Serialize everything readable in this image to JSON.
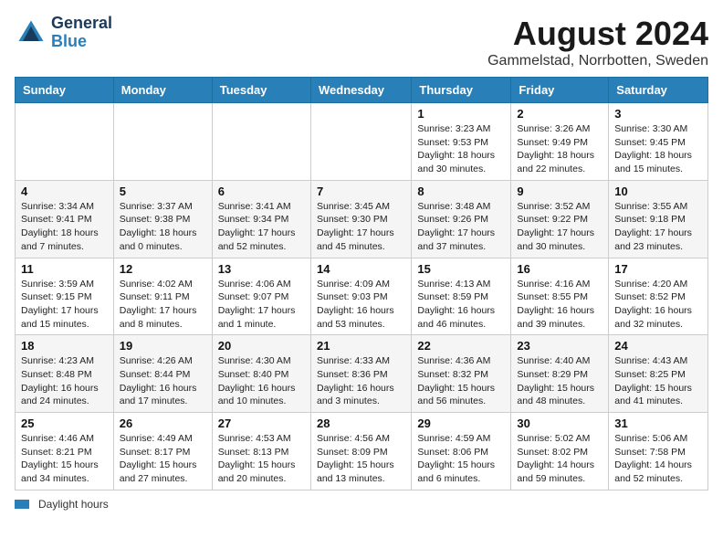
{
  "header": {
    "logo_line1": "General",
    "logo_line2": "Blue",
    "month": "August 2024",
    "location": "Gammelstad, Norrbotten, Sweden"
  },
  "columns": [
    "Sunday",
    "Monday",
    "Tuesday",
    "Wednesday",
    "Thursday",
    "Friday",
    "Saturday"
  ],
  "weeks": [
    [
      {
        "day": "",
        "info": ""
      },
      {
        "day": "",
        "info": ""
      },
      {
        "day": "",
        "info": ""
      },
      {
        "day": "",
        "info": ""
      },
      {
        "day": "1",
        "info": "Sunrise: 3:23 AM\nSunset: 9:53 PM\nDaylight: 18 hours\nand 30 minutes."
      },
      {
        "day": "2",
        "info": "Sunrise: 3:26 AM\nSunset: 9:49 PM\nDaylight: 18 hours\nand 22 minutes."
      },
      {
        "day": "3",
        "info": "Sunrise: 3:30 AM\nSunset: 9:45 PM\nDaylight: 18 hours\nand 15 minutes."
      }
    ],
    [
      {
        "day": "4",
        "info": "Sunrise: 3:34 AM\nSunset: 9:41 PM\nDaylight: 18 hours\nand 7 minutes."
      },
      {
        "day": "5",
        "info": "Sunrise: 3:37 AM\nSunset: 9:38 PM\nDaylight: 18 hours\nand 0 minutes."
      },
      {
        "day": "6",
        "info": "Sunrise: 3:41 AM\nSunset: 9:34 PM\nDaylight: 17 hours\nand 52 minutes."
      },
      {
        "day": "7",
        "info": "Sunrise: 3:45 AM\nSunset: 9:30 PM\nDaylight: 17 hours\nand 45 minutes."
      },
      {
        "day": "8",
        "info": "Sunrise: 3:48 AM\nSunset: 9:26 PM\nDaylight: 17 hours\nand 37 minutes."
      },
      {
        "day": "9",
        "info": "Sunrise: 3:52 AM\nSunset: 9:22 PM\nDaylight: 17 hours\nand 30 minutes."
      },
      {
        "day": "10",
        "info": "Sunrise: 3:55 AM\nSunset: 9:18 PM\nDaylight: 17 hours\nand 23 minutes."
      }
    ],
    [
      {
        "day": "11",
        "info": "Sunrise: 3:59 AM\nSunset: 9:15 PM\nDaylight: 17 hours\nand 15 minutes."
      },
      {
        "day": "12",
        "info": "Sunrise: 4:02 AM\nSunset: 9:11 PM\nDaylight: 17 hours\nand 8 minutes."
      },
      {
        "day": "13",
        "info": "Sunrise: 4:06 AM\nSunset: 9:07 PM\nDaylight: 17 hours\nand 1 minute."
      },
      {
        "day": "14",
        "info": "Sunrise: 4:09 AM\nSunset: 9:03 PM\nDaylight: 16 hours\nand 53 minutes."
      },
      {
        "day": "15",
        "info": "Sunrise: 4:13 AM\nSunset: 8:59 PM\nDaylight: 16 hours\nand 46 minutes."
      },
      {
        "day": "16",
        "info": "Sunrise: 4:16 AM\nSunset: 8:55 PM\nDaylight: 16 hours\nand 39 minutes."
      },
      {
        "day": "17",
        "info": "Sunrise: 4:20 AM\nSunset: 8:52 PM\nDaylight: 16 hours\nand 32 minutes."
      }
    ],
    [
      {
        "day": "18",
        "info": "Sunrise: 4:23 AM\nSunset: 8:48 PM\nDaylight: 16 hours\nand 24 minutes."
      },
      {
        "day": "19",
        "info": "Sunrise: 4:26 AM\nSunset: 8:44 PM\nDaylight: 16 hours\nand 17 minutes."
      },
      {
        "day": "20",
        "info": "Sunrise: 4:30 AM\nSunset: 8:40 PM\nDaylight: 16 hours\nand 10 minutes."
      },
      {
        "day": "21",
        "info": "Sunrise: 4:33 AM\nSunset: 8:36 PM\nDaylight: 16 hours\nand 3 minutes."
      },
      {
        "day": "22",
        "info": "Sunrise: 4:36 AM\nSunset: 8:32 PM\nDaylight: 15 hours\nand 56 minutes."
      },
      {
        "day": "23",
        "info": "Sunrise: 4:40 AM\nSunset: 8:29 PM\nDaylight: 15 hours\nand 48 minutes."
      },
      {
        "day": "24",
        "info": "Sunrise: 4:43 AM\nSunset: 8:25 PM\nDaylight: 15 hours\nand 41 minutes."
      }
    ],
    [
      {
        "day": "25",
        "info": "Sunrise: 4:46 AM\nSunset: 8:21 PM\nDaylight: 15 hours\nand 34 minutes."
      },
      {
        "day": "26",
        "info": "Sunrise: 4:49 AM\nSunset: 8:17 PM\nDaylight: 15 hours\nand 27 minutes."
      },
      {
        "day": "27",
        "info": "Sunrise: 4:53 AM\nSunset: 8:13 PM\nDaylight: 15 hours\nand 20 minutes."
      },
      {
        "day": "28",
        "info": "Sunrise: 4:56 AM\nSunset: 8:09 PM\nDaylight: 15 hours\nand 13 minutes."
      },
      {
        "day": "29",
        "info": "Sunrise: 4:59 AM\nSunset: 8:06 PM\nDaylight: 15 hours\nand 6 minutes."
      },
      {
        "day": "30",
        "info": "Sunrise: 5:02 AM\nSunset: 8:02 PM\nDaylight: 14 hours\nand 59 minutes."
      },
      {
        "day": "31",
        "info": "Sunrise: 5:06 AM\nSunset: 7:58 PM\nDaylight: 14 hours\nand 52 minutes."
      }
    ]
  ],
  "footer": {
    "label": "Daylight hours"
  }
}
